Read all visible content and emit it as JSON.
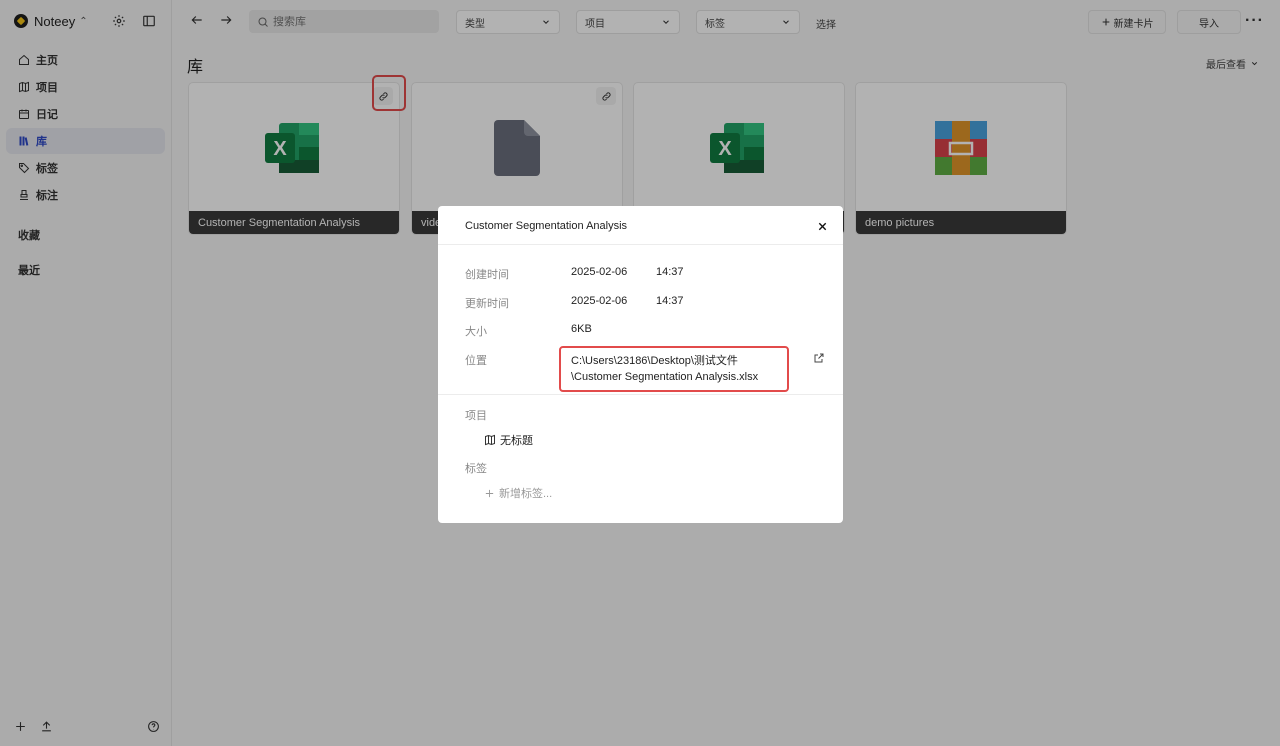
{
  "app": {
    "name": "Noteey"
  },
  "sidebar": {
    "items": [
      {
        "label": "主页",
        "icon": "home-icon"
      },
      {
        "label": "项目",
        "icon": "map-icon"
      },
      {
        "label": "日记",
        "icon": "calendar-icon"
      },
      {
        "label": "库",
        "icon": "library-icon",
        "active": true
      },
      {
        "label": "标签",
        "icon": "tag-icon"
      },
      {
        "label": "标注",
        "icon": "highlighter-icon"
      }
    ],
    "favorites_label": "收藏",
    "recent_label": "最近"
  },
  "toolbar": {
    "search_placeholder": "搜索库",
    "filter_type": "类型",
    "filter_project": "项目",
    "filter_tag": "标签",
    "select_label": "选择",
    "new_card_label": "新建卡片",
    "import_label": "导入"
  },
  "main": {
    "title": "库",
    "sort_label": "最后查看",
    "cards": [
      {
        "name": "Customer Segmentation Analysis",
        "type": "excel",
        "linked": true
      },
      {
        "name": "video",
        "type": "file",
        "linked": true
      },
      {
        "name": "",
        "type": "excel",
        "linked": false
      },
      {
        "name": "demo pictures",
        "type": "archive",
        "linked": false
      }
    ]
  },
  "modal": {
    "title": "Customer Segmentation Analysis",
    "created_label": "创建时间",
    "created_date": "2025-02-06",
    "created_time": "14:37",
    "updated_label": "更新时间",
    "updated_date": "2025-02-06",
    "updated_time": "14:37",
    "size_label": "大小",
    "size_value": "6KB",
    "location_label": "位置",
    "location_line1": "C:\\Users\\23186\\Desktop\\测试文件",
    "location_line2": "\\Customer Segmentation Analysis.xlsx",
    "project_section": "项目",
    "project_item": "无标题",
    "tags_section": "标签",
    "add_tag_label": "新增标签..."
  },
  "colors": {
    "accent": "#2f49c7",
    "highlight": "#e24b4b",
    "excel_green": "#1d6f42"
  }
}
